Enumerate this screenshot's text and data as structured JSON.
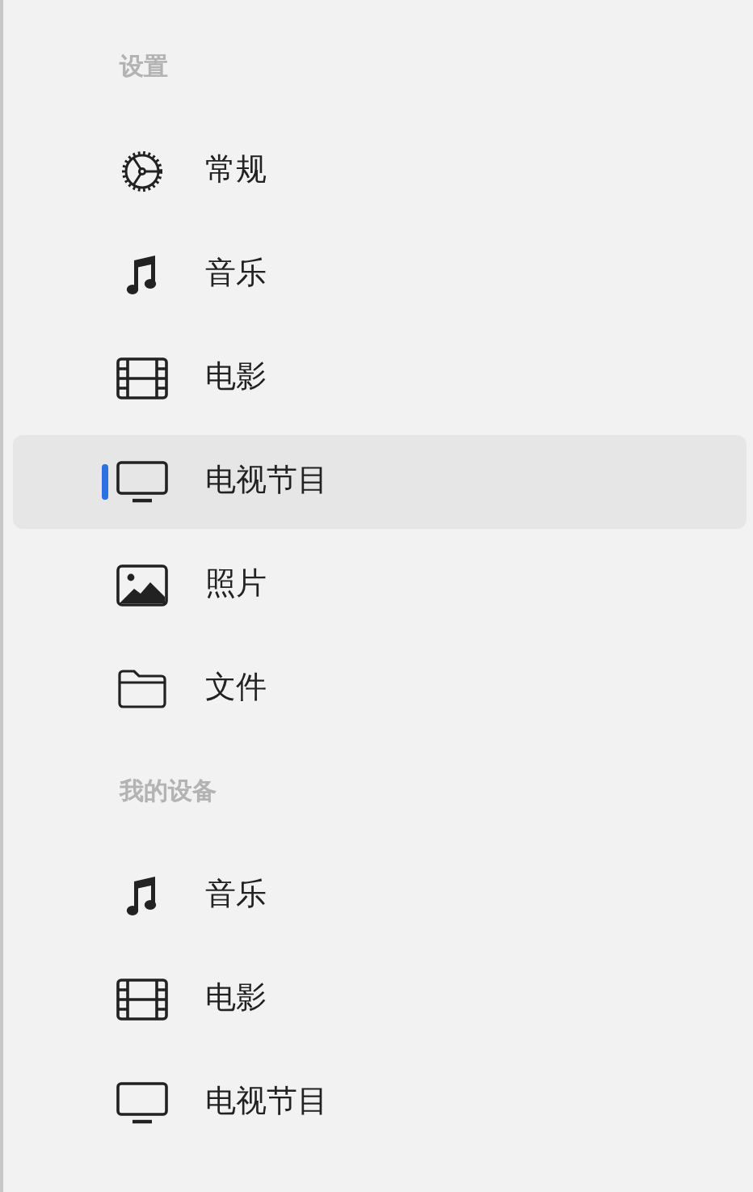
{
  "sections": [
    {
      "title": "设置",
      "items": [
        {
          "label": "常规",
          "kind": "gear",
          "selected": false
        },
        {
          "label": "音乐",
          "kind": "music",
          "selected": false
        },
        {
          "label": "电影",
          "kind": "film",
          "selected": false
        },
        {
          "label": "电视节目",
          "kind": "tv",
          "selected": true
        },
        {
          "label": "照片",
          "kind": "photo",
          "selected": false
        },
        {
          "label": "文件",
          "kind": "folder",
          "selected": false
        }
      ]
    },
    {
      "title": "我的设备",
      "items": [
        {
          "label": "音乐",
          "kind": "music",
          "selected": false
        },
        {
          "label": "电影",
          "kind": "film",
          "selected": false
        },
        {
          "label": "电视节目",
          "kind": "tv",
          "selected": false
        }
      ]
    }
  ]
}
